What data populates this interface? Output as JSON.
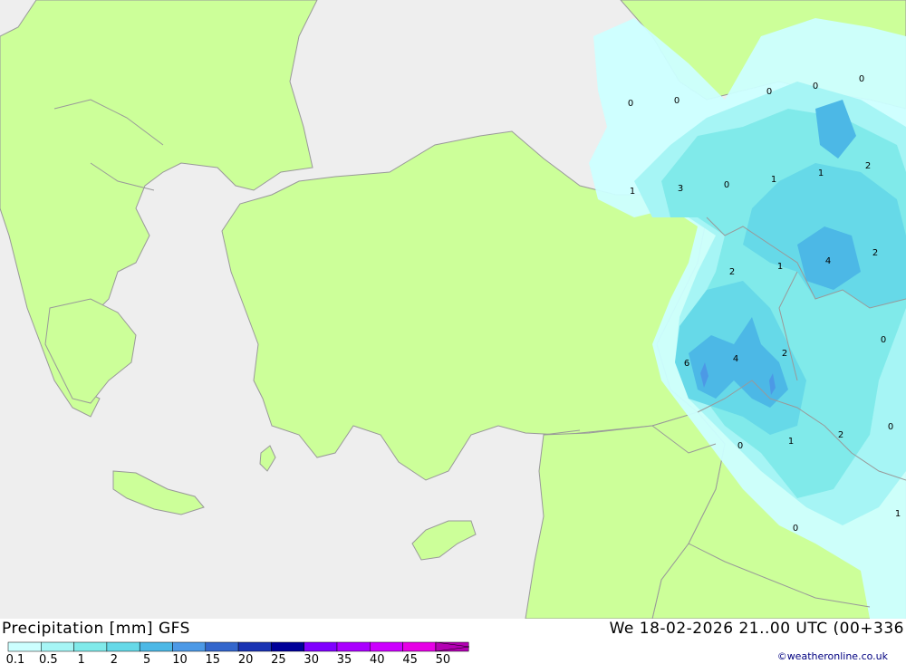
{
  "title": "Precipitation [mm] GFS",
  "valid_time": "We 18-02-2026 21..00 UTC (00+336",
  "credit": "©weatheronline.co.uk",
  "colors": {
    "sea": "#eeeeee",
    "land": "#ccff99",
    "border": "#999999"
  },
  "legend": {
    "labels": [
      "0.1",
      "0.5",
      "1",
      "2",
      "5",
      "10",
      "15",
      "20",
      "25",
      "30",
      "35",
      "40",
      "45",
      "50"
    ],
    "colors": [
      "#ccffff",
      "#a6f5f5",
      "#80eaea",
      "#66d9e8",
      "#4cb8e6",
      "#4c99e6",
      "#3366cc",
      "#1a33b3",
      "#000099",
      "#8000ff",
      "#aa00ff",
      "#cc00ff",
      "#e600e6",
      "#b300b3"
    ]
  },
  "precip_labels": [
    "0",
    "0",
    "0",
    "0",
    "0",
    "1",
    "3",
    "0",
    "1",
    "1",
    "2",
    "2",
    "1",
    "4",
    "2",
    "6",
    "4",
    "2",
    "0",
    "0",
    "1",
    "2",
    "0",
    "0",
    "1"
  ]
}
